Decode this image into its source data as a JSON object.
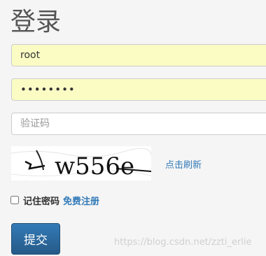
{
  "page": {
    "title": "登录"
  },
  "form": {
    "username_value": "root",
    "password_value": "12345678",
    "captcha_placeholder": "验证码",
    "captcha_text": "w556e",
    "refresh_label": "点击刷新",
    "remember_label": "记住密码",
    "register_label": "免费注册",
    "submit_label": "提交"
  },
  "watermark": {
    "text": "https://blog.csdn.net/zzti_erlie"
  },
  "colors": {
    "autofill": "#fbfcc4",
    "link": "#337ab7",
    "button": "#2f6fad"
  }
}
